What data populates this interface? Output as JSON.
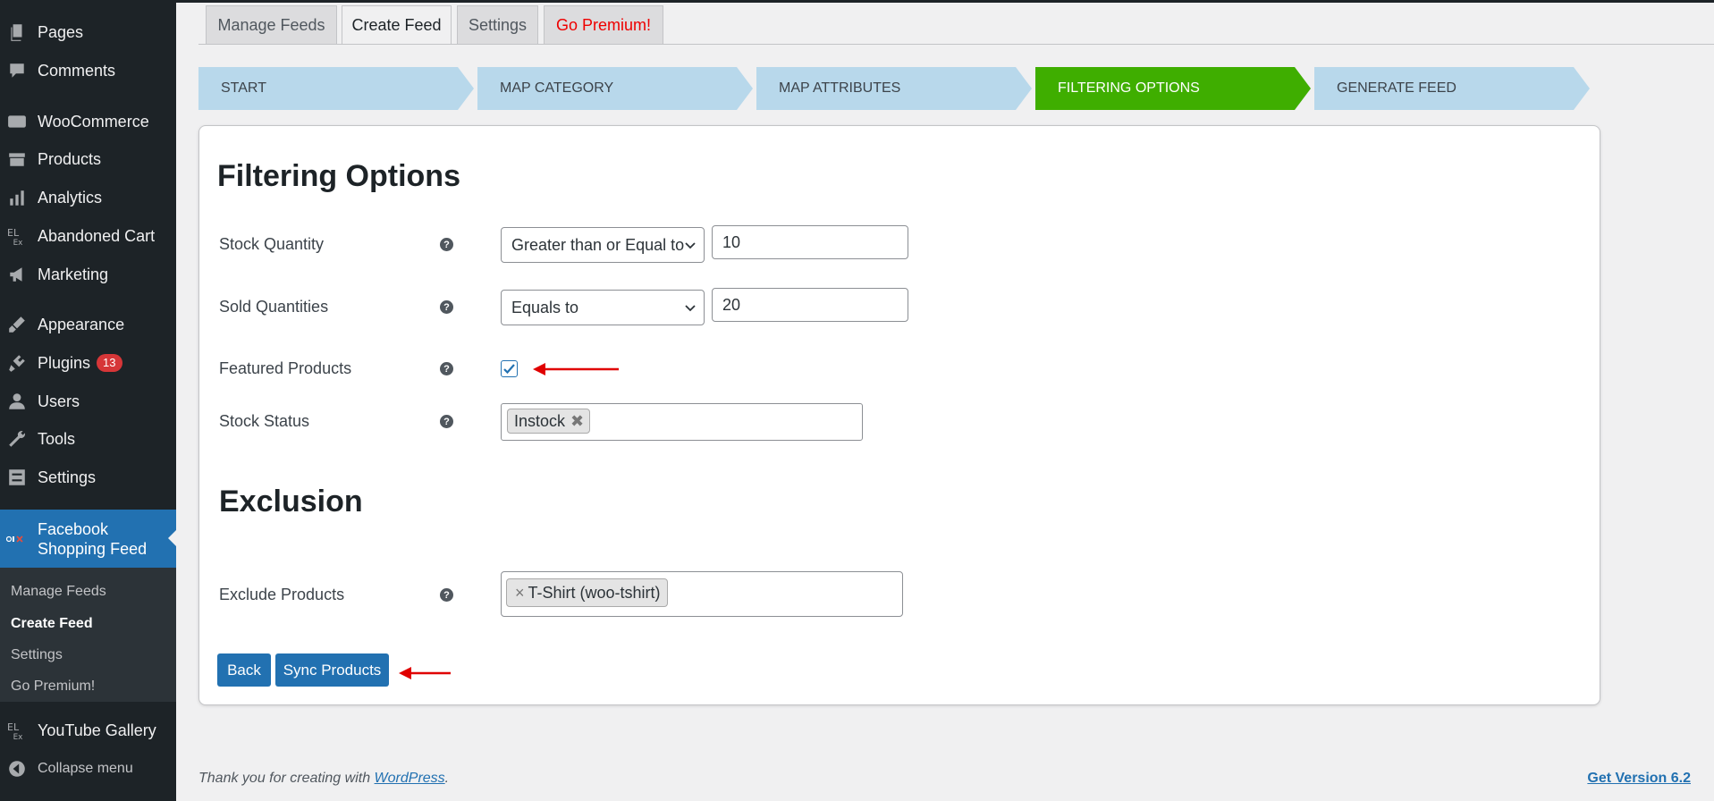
{
  "sidebar": {
    "items": [
      {
        "label": "Pages",
        "icon": "pages-icon"
      },
      {
        "label": "Comments",
        "icon": "comments-icon"
      },
      {
        "label": "WooCommerce",
        "icon": "woocommerce-icon"
      },
      {
        "label": "Products",
        "icon": "products-icon"
      },
      {
        "label": "Analytics",
        "icon": "analytics-icon"
      },
      {
        "label": "Abandoned Cart",
        "icon": "elex-icon"
      },
      {
        "label": "Marketing",
        "icon": "megaphone-icon"
      },
      {
        "label": "Appearance",
        "icon": "paintbrush-icon"
      },
      {
        "label": "Plugins",
        "icon": "plugin-icon",
        "badge": "13"
      },
      {
        "label": "Users",
        "icon": "users-icon"
      },
      {
        "label": "Tools",
        "icon": "wrench-icon"
      },
      {
        "label": "Settings",
        "icon": "settings-icon"
      }
    ],
    "active": {
      "label_line1": "Facebook",
      "label_line2": "Shopping Feed",
      "icon": "elex-logo-icon"
    },
    "submenu": [
      "Manage Feeds",
      "Create Feed",
      "Settings",
      "Go Premium!"
    ],
    "submenu_current": "Create Feed",
    "after": [
      {
        "label": "YouTube Gallery",
        "icon": "elex-icon"
      },
      {
        "label": "Collapse menu",
        "icon": "collapse-icon"
      }
    ]
  },
  "tabs": [
    "Manage Feeds",
    "Create Feed",
    "Settings",
    "Go Premium!"
  ],
  "active_tab": "Create Feed",
  "steps": [
    "START",
    "MAP CATEGORY",
    "MAP ATTRIBUTES",
    "FILTERING OPTIONS",
    "GENERATE FEED"
  ],
  "active_step": "FILTERING OPTIONS",
  "colors": {
    "step_inactive": "#b8d8eb",
    "step_active": "#3fae00",
    "primary": "#2271b1",
    "annotation_red": "#e00000"
  },
  "filtering": {
    "title": "Filtering Options",
    "stock_quantity": {
      "label": "Stock Quantity",
      "operator": "Greater than or Equal to",
      "value": "10"
    },
    "sold_quantities": {
      "label": "Sold Quantities",
      "operator": "Equals to",
      "value": "20"
    },
    "featured_products": {
      "label": "Featured Products",
      "checked": true
    },
    "stock_status": {
      "label": "Stock Status",
      "tokens": [
        "Instock"
      ]
    },
    "help_glyph": "?"
  },
  "exclusion": {
    "title": "Exclusion",
    "exclude_products": {
      "label": "Exclude Products",
      "tokens": [
        "T-Shirt (woo-tshirt)"
      ]
    }
  },
  "buttons": {
    "back": "Back",
    "sync": "Sync Products"
  },
  "footer": {
    "thanks_prefix": "Thank you for creating with ",
    "thanks_link": "WordPress",
    "thanks_suffix": ".",
    "version": "Get Version 6.2"
  }
}
